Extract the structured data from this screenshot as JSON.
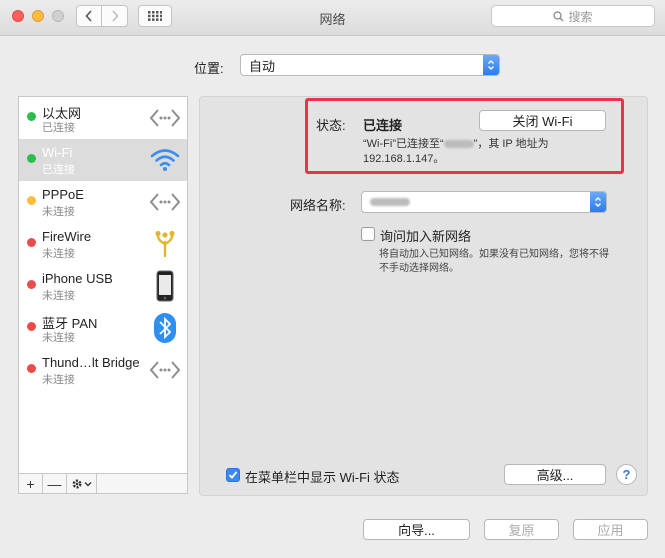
{
  "window": {
    "title": "网络",
    "search_placeholder": "搜索"
  },
  "location": {
    "label": "位置:",
    "value": "自动"
  },
  "services": [
    {
      "name": "以太网",
      "status": "已连接",
      "dot": "#2dbd4e",
      "icon": "ethernet-arrows-icon"
    },
    {
      "name": "Wi-Fi",
      "status": "已连接",
      "dot": "#2dbd4e",
      "icon": "wifi-icon"
    },
    {
      "name": "PPPoE",
      "status": "未连接",
      "dot": "#fdbc40",
      "icon": "ppp-arrows-icon"
    },
    {
      "name": "FireWire",
      "status": "未连接",
      "dot": "#ec4b4b",
      "icon": "firewire-icon"
    },
    {
      "name": "iPhone USB",
      "status": "未连接",
      "dot": "#ec4b4b",
      "icon": "iphone-icon"
    },
    {
      "name": "蓝牙 PAN",
      "status": "未连接",
      "dot": "#ec4b4b",
      "icon": "bluetooth-icon"
    },
    {
      "name": "Thund…lt Bridge",
      "status": "未连接",
      "dot": "#ec4b4b",
      "icon": "thunderbolt-arrows-icon"
    }
  ],
  "sidebar_buttons": {
    "add": "+",
    "remove": "—"
  },
  "detail": {
    "status_label": "状态:",
    "status_value": "已连接",
    "wifi_off_button": "关闭 Wi-Fi",
    "status_desc_prefix": "“Wi-Fi”已连接至“",
    "status_desc_suffix": "”，其 IP 地址为",
    "ip_address": "192.168.1.147。",
    "network_name_label": "网络名称:",
    "ask_join_label": "询问加入新网络",
    "ask_join_desc": "将自动加入已知网络。如果没有已知网络，您将不得不手动选择网络。",
    "show_in_menubar_label": "在菜单栏中显示 Wi-Fi 状态",
    "advanced_button": "高级...",
    "help_button": "?"
  },
  "bottom": {
    "assist_button": "向导...",
    "revert_button": "复原",
    "apply_button": "应用"
  },
  "colors": {
    "accent": "#3b87f3",
    "highlight_border": "#e8334a"
  }
}
